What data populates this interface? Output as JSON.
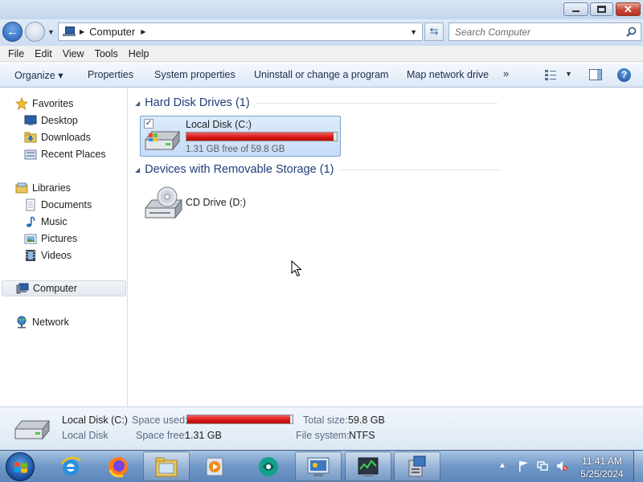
{
  "window": {
    "minimize_label": "–",
    "maximize_label": "",
    "close_label": "✕"
  },
  "address": {
    "location": "Computer",
    "search_placeholder": "Search Computer"
  },
  "menu": [
    "File",
    "Edit",
    "View",
    "Tools",
    "Help"
  ],
  "commands": {
    "organize": "Organize ▾",
    "properties": "Properties",
    "system_properties": "System properties",
    "uninstall": "Uninstall or change a program",
    "map_drive": "Map network drive",
    "more": "»"
  },
  "nav": {
    "favorites": "Favorites",
    "desktop": "Desktop",
    "downloads": "Downloads",
    "recent": "Recent Places",
    "libraries": "Libraries",
    "documents": "Documents",
    "music": "Music",
    "pictures": "Pictures",
    "videos": "Videos",
    "computer": "Computer",
    "network": "Network"
  },
  "groups": {
    "hdd": "Hard Disk Drives (1)",
    "removable": "Devices with Removable Storage (1)"
  },
  "drives": {
    "local": {
      "name": "Local Disk (C:)",
      "free_text": "1.31 GB free of 59.8 GB",
      "used_fraction": 0.978
    },
    "cd": {
      "name": "CD Drive (D:)"
    }
  },
  "details": {
    "name": "Local Disk (C:)",
    "type": "Local Disk",
    "space_used_label": "Space used:",
    "space_free_label": "Space free:",
    "space_free": "1.31 GB",
    "total_size_label": "Total size:",
    "total_size": "59.8 GB",
    "filesystem_label": "File system:",
    "filesystem": "NTFS"
  },
  "clock": {
    "time": "11:41 AM",
    "date": "5/25/2024"
  },
  "colors": {
    "usage_bar": "#d81414",
    "group_title": "#1e3d7a"
  }
}
